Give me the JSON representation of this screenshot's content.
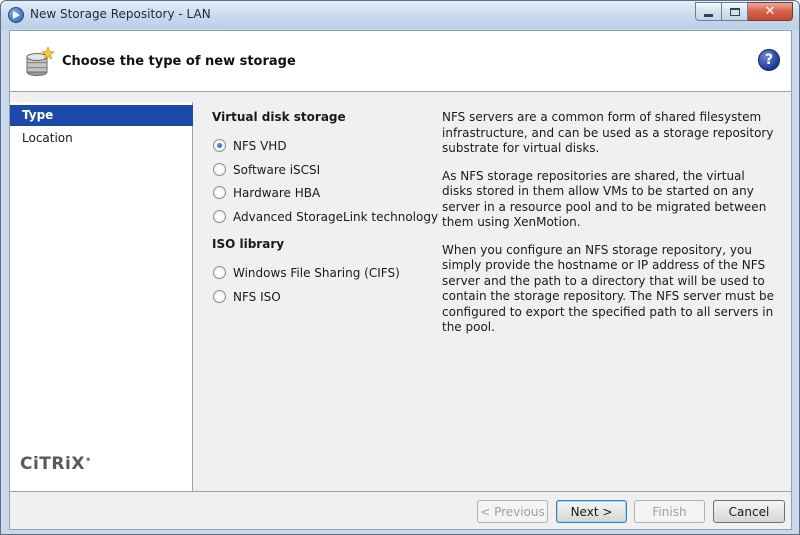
{
  "window": {
    "title": "New Storage Repository - LAN",
    "close_glyph": "✕"
  },
  "header": {
    "title": "Choose the type of new storage",
    "help_glyph": "?"
  },
  "sidebar": {
    "items": [
      {
        "label": "Type",
        "active": true
      },
      {
        "label": "Location",
        "active": false
      }
    ],
    "logo_text": "CiTRiX"
  },
  "virtual_disk": {
    "heading": "Virtual disk storage",
    "options": [
      {
        "label": "NFS VHD",
        "checked": true
      },
      {
        "label": "Software iSCSI",
        "checked": false
      },
      {
        "label": "Hardware HBA",
        "checked": false
      },
      {
        "label": "Advanced StorageLink technology",
        "checked": false
      }
    ]
  },
  "iso_library": {
    "heading": "ISO library",
    "options": [
      {
        "label": "Windows File Sharing (CIFS)",
        "checked": false
      },
      {
        "label": "NFS ISO",
        "checked": false
      }
    ]
  },
  "description": {
    "paragraphs": [
      "NFS servers are a common form of shared filesystem infrastructure, and can be used as a storage repository substrate for virtual disks.",
      "As NFS storage repositories are shared, the virtual disks stored in them allow VMs to be started on any server in a resource pool and to be migrated between them using XenMotion.",
      "When you configure an NFS storage repository, you simply provide the hostname or IP address of the NFS server and the path to a directory that will be used to contain the storage repository. The NFS server must be configured to export the specified path to all servers in the pool."
    ]
  },
  "footer": {
    "previous_label": "< Previous",
    "next_label": "Next >",
    "finish_label": "Finish",
    "cancel_label": "Cancel"
  },
  "colors": {
    "selection": "#1d4aa8",
    "close_button": "#c44a32"
  }
}
